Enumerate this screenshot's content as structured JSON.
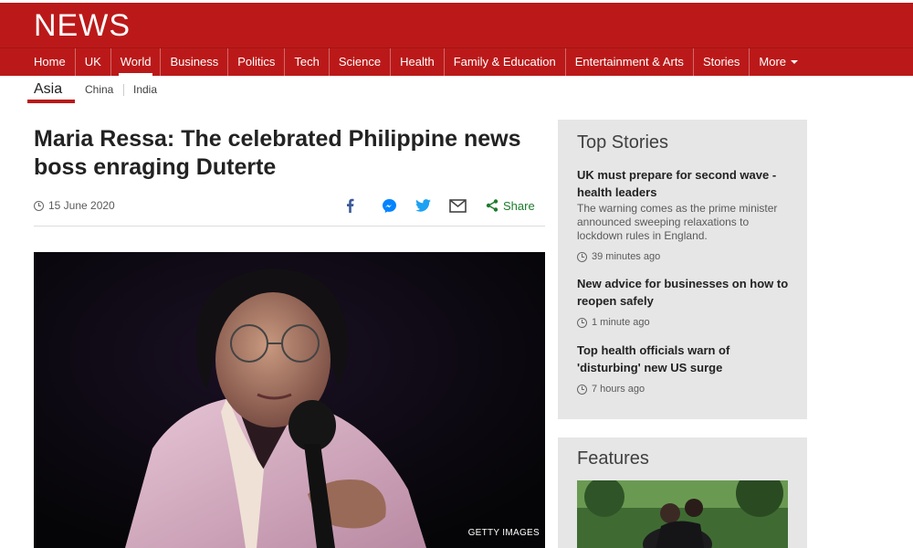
{
  "brand": {
    "logo_text": "NEWS",
    "accent": "#bb1919"
  },
  "nav": {
    "items": [
      "Home",
      "UK",
      "World",
      "Business",
      "Politics",
      "Tech",
      "Science",
      "Health",
      "Family & Education",
      "Entertainment & Arts",
      "Stories",
      "More"
    ],
    "active": "World"
  },
  "subnav": {
    "current": "Asia",
    "links": [
      "China",
      "India"
    ]
  },
  "article": {
    "title": "Maria Ressa: The celebrated Philippine news boss enraging Duterte",
    "date": "15 June 2020",
    "share_label": "Share",
    "share_icons": [
      "facebook-icon",
      "messenger-icon",
      "twitter-icon",
      "email-icon",
      "share-icon"
    ],
    "image_credit": "GETTY IMAGES"
  },
  "top_stories": {
    "heading": "Top Stories",
    "stories": [
      {
        "title": "UK must prepare for second wave - health leaders",
        "summary": "The warning comes as the prime minister announced sweeping relaxations to lockdown rules in England.",
        "time": "39 minutes ago"
      },
      {
        "title": "New advice for businesses on how to reopen safely",
        "time": "1 minute ago"
      },
      {
        "title": "Top health officials warn of 'disturbing' new US surge",
        "time": "7 hours ago"
      }
    ]
  },
  "features": {
    "heading": "Features"
  }
}
